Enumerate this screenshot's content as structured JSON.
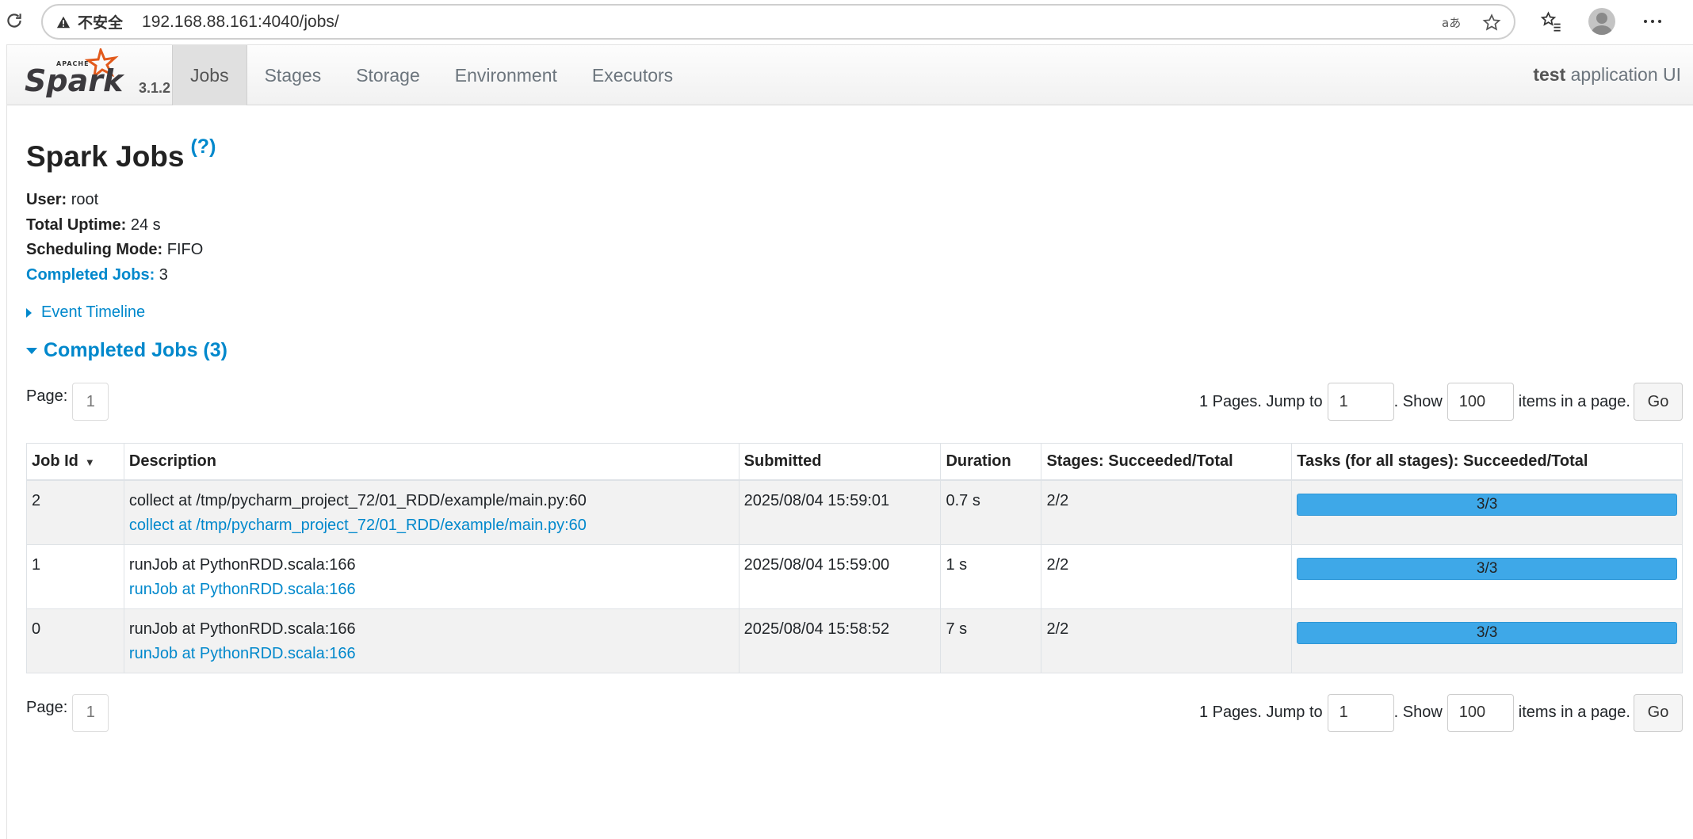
{
  "browser": {
    "insecure_label": "不安全",
    "url": "192.168.88.161:4040/jobs/"
  },
  "navbar": {
    "version": "3.1.2",
    "tabs": [
      {
        "label": "Jobs",
        "active": true
      },
      {
        "label": "Stages"
      },
      {
        "label": "Storage"
      },
      {
        "label": "Environment"
      },
      {
        "label": "Executors"
      }
    ],
    "app_name": "test",
    "app_suffix": " application UI"
  },
  "page": {
    "title": "Spark Jobs",
    "help": "(?)",
    "summary": {
      "user_label": "User:",
      "user_value": " root",
      "uptime_label": "Total Uptime:",
      "uptime_value": " 24 s",
      "mode_label": "Scheduling Mode:",
      "mode_value": " FIFO",
      "completed_label": "Completed Jobs:",
      "completed_value": " 3"
    },
    "timeline_label": "Event Timeline",
    "section_label": "Completed Jobs (3)"
  },
  "pager": {
    "page_label": "Page:",
    "page_number": "1",
    "pages_text": "1 Pages. Jump to",
    "jump_value": "1",
    "show_text": ". Show",
    "show_value": "100",
    "items_text": "items in a page.",
    "go_label": "Go"
  },
  "table": {
    "headers": [
      "Job Id",
      "Description",
      "Submitted",
      "Duration",
      "Stages: Succeeded/Total",
      "Tasks (for all stages): Succeeded/Total"
    ],
    "rows": [
      {
        "id": "2",
        "desc": "collect at /tmp/pycharm_project_72/01_RDD/example/main.py:60",
        "desc_link": "collect at /tmp/pycharm_project_72/01_RDD/example/main.py:60",
        "submitted": "2025/08/04 15:59:01",
        "duration": "0.7 s",
        "stages": "2/2",
        "tasks": "3/3",
        "tasks_fraction": 1.0
      },
      {
        "id": "1",
        "desc": "runJob at PythonRDD.scala:166",
        "desc_link": "runJob at PythonRDD.scala:166",
        "submitted": "2025/08/04 15:59:00",
        "duration": "1 s",
        "stages": "2/2",
        "tasks": "3/3",
        "tasks_fraction": 1.0
      },
      {
        "id": "0",
        "desc": "runJob at PythonRDD.scala:166",
        "desc_link": "runJob at PythonRDD.scala:166",
        "submitted": "2025/08/04 15:58:52",
        "duration": "7 s",
        "stages": "2/2",
        "tasks": "3/3",
        "tasks_fraction": 1.0
      }
    ]
  },
  "colors": {
    "link": "#0088cc",
    "progress": "#3ea8e8",
    "spark_orange": "#e25a1c"
  }
}
